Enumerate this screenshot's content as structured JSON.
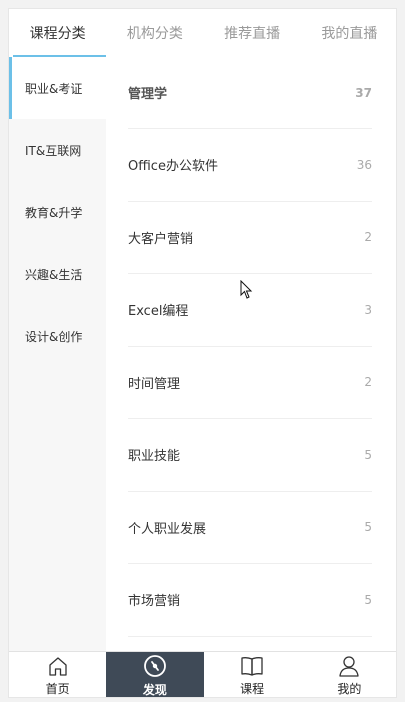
{
  "top_tabs": [
    {
      "label": "课程分类",
      "active": true
    },
    {
      "label": "机构分类",
      "active": false
    },
    {
      "label": "推荐直播",
      "active": false
    },
    {
      "label": "我的直播",
      "active": false
    }
  ],
  "categories": [
    {
      "label": "职业&考证",
      "active": true
    },
    {
      "label": "IT&互联网",
      "active": false
    },
    {
      "label": "教育&升学",
      "active": false
    },
    {
      "label": "兴趣&生活",
      "active": false
    },
    {
      "label": "设计&创作",
      "active": false
    }
  ],
  "subcategories": [
    {
      "name": "管理学",
      "count": "37"
    },
    {
      "name": "Office办公软件",
      "count": "36"
    },
    {
      "name": "大客户营销",
      "count": "2"
    },
    {
      "name": "Excel编程",
      "count": "3"
    },
    {
      "name": "时间管理",
      "count": "2"
    },
    {
      "name": "职业技能",
      "count": "5"
    },
    {
      "name": "个人职业发展",
      "count": "5"
    },
    {
      "name": "市场营销",
      "count": "5"
    }
  ],
  "bottom_nav": [
    {
      "label": "首页",
      "icon": "home-icon",
      "active": false
    },
    {
      "label": "发现",
      "icon": "compass-icon",
      "active": true
    },
    {
      "label": "课程",
      "icon": "book-icon",
      "active": false
    },
    {
      "label": "我的",
      "icon": "user-icon",
      "active": false
    }
  ],
  "colors": {
    "accent": "#6cc0e8",
    "nav_active_bg": "#3f4a57",
    "sidebar_bg": "#f7f7f7"
  }
}
